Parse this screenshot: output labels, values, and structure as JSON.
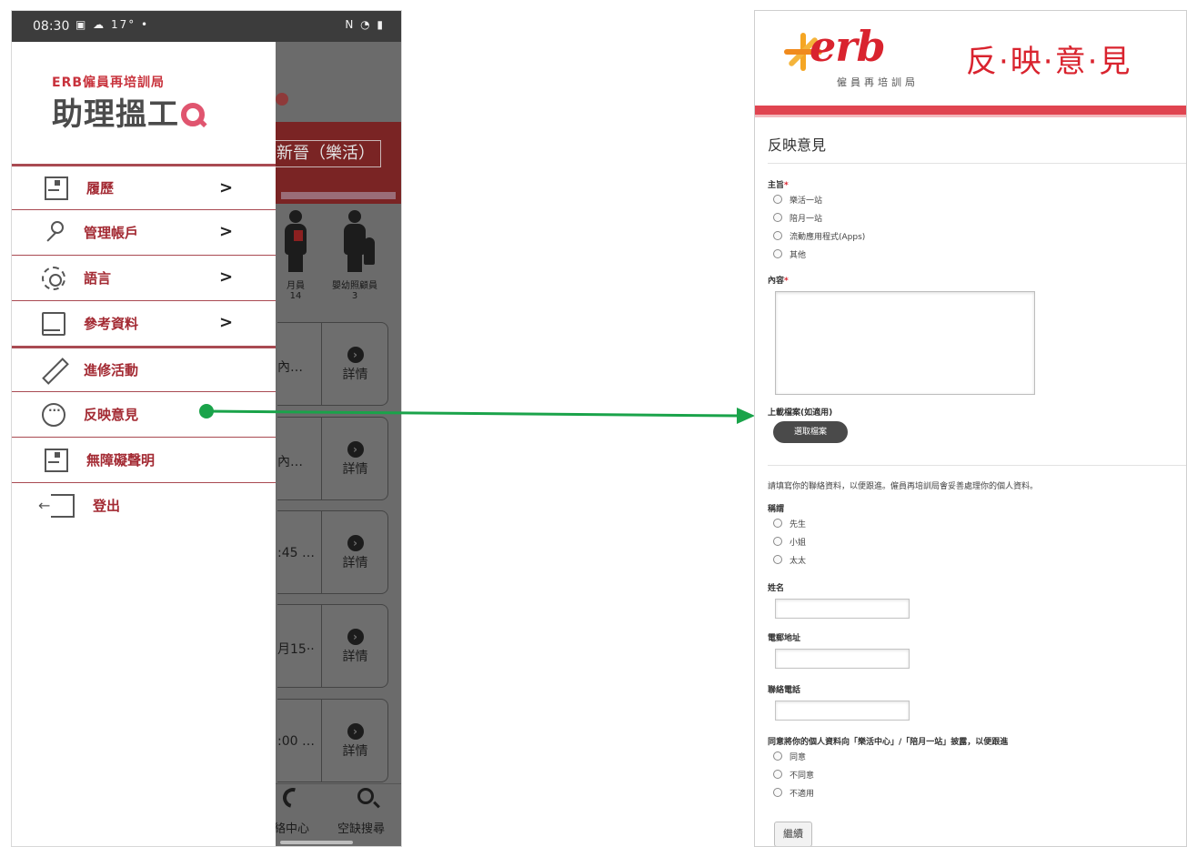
{
  "phone": {
    "status_bar": {
      "time": "08:30",
      "left_icons": "▣ ☁ 17° •",
      "right_icons": "N ◔ ▮"
    },
    "background_app": {
      "banner_text": "新晉（樂活）",
      "stats": [
        {
          "label": "月員",
          "value": "14"
        },
        {
          "label": "嬰幼照顧員",
          "value": "3"
        }
      ],
      "cards": [
        {
          "snippet": "內…",
          "detail": "詳情"
        },
        {
          "snippet": "內…",
          "detail": "詳情"
        },
        {
          "snippet": ":45 …",
          "detail": "詳情"
        },
        {
          "snippet": "月15··",
          "detail": "詳情"
        },
        {
          "snippet": ":00 …",
          "detail": "詳情"
        }
      ],
      "bottom_nav": [
        "絡中心",
        "空缺搜尋"
      ]
    },
    "drawer": {
      "brand_sub": "ERB僱員再培訓局",
      "brand_main": "助理搵工",
      "menu": [
        {
          "label": "履歷",
          "icon": "document-icon",
          "has_chevron": true,
          "chevron": ">"
        },
        {
          "label": "管理帳戶",
          "icon": "key-icon",
          "has_chevron": true,
          "chevron": ">"
        },
        {
          "label": "語言",
          "icon": "gear-icon",
          "has_chevron": true,
          "chevron": ">"
        },
        {
          "label": "參考資料",
          "icon": "book-icon",
          "has_chevron": true,
          "chevron": ">"
        },
        {
          "label": "進修活動",
          "icon": "pencil-icon",
          "has_chevron": false
        },
        {
          "label": "反映意見",
          "icon": "chat-bubble-icon",
          "has_chevron": false
        },
        {
          "label": "無障礙聲明",
          "icon": "document-icon",
          "has_chevron": false
        },
        {
          "label": "登出",
          "icon": "logout-icon",
          "has_chevron": false
        }
      ]
    }
  },
  "arrow": {
    "color": "#1aa34a"
  },
  "form": {
    "header": {
      "logo_word": "erb",
      "logo_sub": "僱員再培訓局",
      "title": "反·映·意·見"
    },
    "page_title": "反映意見",
    "subject": {
      "label": "主旨",
      "required": "*",
      "options": [
        "樂活一站",
        "陪月一站",
        "流動應用程式(Apps)",
        "其他"
      ]
    },
    "content": {
      "label": "內容",
      "required": "*"
    },
    "upload": {
      "label": "上載檔案(如適用)",
      "button": "選取檔案"
    },
    "contact_note": "請填寫你的聯絡資料，以便跟進。僱員再培訓局會妥善處理你的個人資料。",
    "salutation": {
      "label": "稱謂",
      "options": [
        "先生",
        "小姐",
        "太太"
      ]
    },
    "name_label": "姓名",
    "email_label": "電郵地址",
    "phone_label": "聯絡電話",
    "consent": {
      "label": "同意將你的個人資料向「樂活中心」/「陪月一站」披露，以便跟進",
      "options": [
        "同意",
        "不同意",
        "不適用"
      ]
    },
    "submit": "繼續"
  },
  "colors": {
    "accent": "#d9232e",
    "menu_text": "#a32a33",
    "arrow": "#1aa34a"
  }
}
